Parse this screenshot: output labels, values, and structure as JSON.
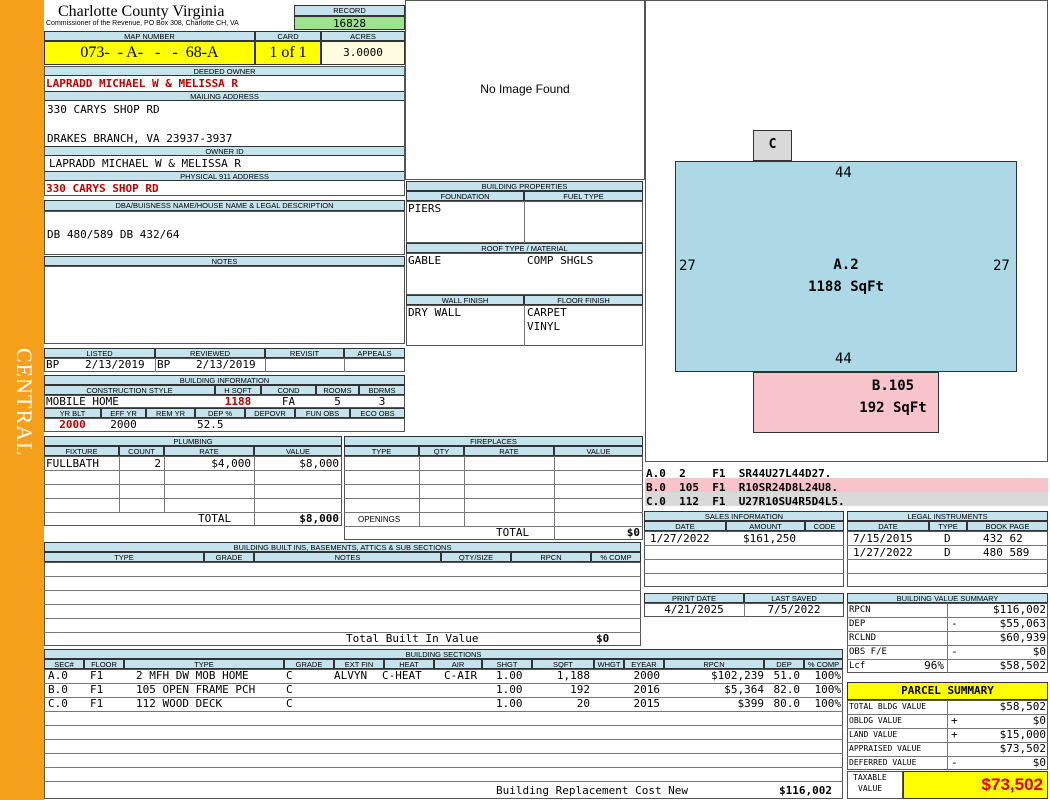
{
  "sidebar": {
    "label": "CENTRAL",
    "color": "#f5a01a"
  },
  "header": {
    "county": "Charlotte County Virginia",
    "commissioner": "Commissioner of the Revenue, PO Box 308, Charlotte CH, VA"
  },
  "record": {
    "label": "RECORD",
    "value": "16828"
  },
  "map_number": {
    "label": "MAP NUMBER",
    "value": "073-  - A-   -   -  68-A"
  },
  "card": {
    "label": "CARD",
    "value": "1 of 1"
  },
  "acres": {
    "label": "ACRES",
    "value": "3.0000"
  },
  "deeded_owner": {
    "label": "DEEDED OWNER",
    "value": "LAPRADD MICHAEL W & MELISSA R"
  },
  "mailing": {
    "label": "MAILING ADDRESS",
    "line1": "330 CARYS SHOP RD",
    "line2": "DRAKES BRANCH, VA 23937-3937"
  },
  "owner_id": {
    "label": "OWNER ID",
    "value": "LAPRADD MICHAEL W & MELISSA R"
  },
  "physical": {
    "label": "PHYSICAL 911 ADDRESS",
    "value": "330 CARYS SHOP RD"
  },
  "dba": {
    "label": "DBA/BUISNESS NAME/HOUSE NAME & LEGAL DESCRIPTION",
    "value": "DB 480/589 DB 432/64"
  },
  "notes": {
    "label": "NOTES"
  },
  "listed": {
    "listed_label": "LISTED",
    "reviewed_label": "REVIEWED",
    "revisit_label": "REVISIT",
    "appeals_label": "APPEALS",
    "listed_by": "BP",
    "listed_date": "2/13/2019",
    "reviewed_by": "BP",
    "reviewed_date": "2/13/2019"
  },
  "building_info": {
    "label": "BUILDING INFORMATION",
    "style_label": "CONSTRUCTION STYLE",
    "hsqft_label": "H SQFT",
    "cond_label": "COND",
    "rooms_label": "ROOMS",
    "bdrms_label": "BDRMS",
    "style": "MOBILE HOME",
    "hsqft": "1188",
    "cond": "FA",
    "rooms": "5",
    "bdrms": "3",
    "yrblt_label": "YR BLT",
    "effyr_label": "EFF YR",
    "remyr_label": "REM YR",
    "dep_label": "DEP %",
    "depovr_label": "DEPOVR",
    "funobs_label": "FUN OBS",
    "ecoobs_label": "ECO OBS",
    "yrblt": "2000",
    "effyr": "2000",
    "dep": "52.5"
  },
  "image": {
    "text": "No Image Found"
  },
  "building_props": {
    "label": "BUILDING PROPERTIES",
    "foundation_label": "FOUNDATION",
    "fuel_label": "FUEL TYPE",
    "foundation": "PIERS",
    "roof_label": "ROOF TYPE / MATERIAL",
    "roof_type": "GABLE",
    "roof_material": "COMP SHGLS",
    "wall_label": "WALL FINISH",
    "floor_label": "FLOOR FINISH",
    "wall": "DRY WALL",
    "floor1": "CARPET",
    "floor2": "VINYL"
  },
  "sketch": {
    "c_label": "C",
    "top": "44",
    "bottom": "44",
    "left": "27",
    "right": "27",
    "a_label": "A.2",
    "a_area": "1188 SqFt",
    "b_label": "B.105",
    "b_area": "192 SqFt"
  },
  "sketch_legend": [
    {
      "text": "A.0  2    F1  SR44U27L44D27.",
      "color": "#ffffff"
    },
    {
      "text": "B.0  105  F1  R10SR24D8L24U8.",
      "color": "#f7c4cc"
    },
    {
      "text": "C.0  112  F1  U27R10SU4R5D4L5.",
      "color": "#d9d9d9"
    }
  ],
  "plumbing": {
    "label": "PLUMBING",
    "cols": [
      "FIXTURE",
      "COUNT",
      "RATE",
      "VALUE"
    ],
    "rows": [
      {
        "fixture": "FULLBATH",
        "count": "2",
        "rate": "$4,000",
        "value": "$8,000"
      }
    ],
    "total_label": "TOTAL",
    "total": "$8,000"
  },
  "fireplaces": {
    "label": "FIREPLACES",
    "cols": [
      "TYPE",
      "QTY",
      "RATE",
      "VALUE"
    ],
    "openings_label": "OPENINGS",
    "total_label": "TOTAL",
    "total": "$0"
  },
  "builtins": {
    "label": "BUILDING BUILT INS, BASEMENTS, ATTICS & SUB SECTIONS",
    "cols": [
      "TYPE",
      "GRADE",
      "NOTES",
      "QTY/SIZE",
      "RPCN",
      "% COMP"
    ],
    "total_label": "Total Built In Value",
    "total": "$0"
  },
  "sales": {
    "label": "SALES INFORMATION",
    "cols": [
      "DATE",
      "AMOUNT",
      "CODE"
    ],
    "rows": [
      {
        "date": "1/27/2022",
        "amount": "$161,250",
        "code": ""
      }
    ]
  },
  "legal": {
    "label": "LEGAL INSTRUMENTS",
    "cols": [
      "DATE",
      "TYPE",
      "BOOK PAGE"
    ],
    "rows": [
      {
        "date": "7/15/2015",
        "type": "D",
        "book": "432 62"
      },
      {
        "date": "1/27/2022",
        "type": "D",
        "book": "480 589"
      }
    ]
  },
  "print": {
    "print_label": "PRINT DATE",
    "saved_label": "LAST SAVED",
    "print_date": "4/21/2025",
    "saved_date": "7/5/2022"
  },
  "bvs": {
    "label": "BUILDING VALUE SUMMARY",
    "rows": [
      {
        "label": "RPCN",
        "sign": "",
        "value": "$116,002"
      },
      {
        "label": "DEP",
        "sign": "-",
        "value": "$55,063"
      },
      {
        "label": "RCLND",
        "sign": "",
        "value": "$60,939"
      },
      {
        "label": "OBS F/E",
        "sign": "-",
        "value": "$0"
      },
      {
        "label": "Lcf",
        "sign": "96%",
        "value": "$58,502"
      }
    ]
  },
  "parcel": {
    "label": "PARCEL SUMMARY",
    "rows": [
      {
        "label": "TOTAL BLDG VALUE",
        "sign": "",
        "value": "$58,502"
      },
      {
        "label": "OBLDG VALUE",
        "sign": "+",
        "value": "$0"
      },
      {
        "label": "LAND VALUE",
        "sign": "+",
        "value": "$15,000"
      },
      {
        "label": "APPRAISED VALUE",
        "sign": "",
        "value": "$73,502"
      },
      {
        "label": "DEFERRED VALUE",
        "sign": "-",
        "value": "$0"
      }
    ],
    "taxable_label1": "TAXABLE",
    "taxable_label2": "VALUE",
    "taxable": "$73,502"
  },
  "sections": {
    "label": "BUILDING SECTIONS",
    "cols": [
      "SEC#",
      "FLOOR",
      "TYPE",
      "GRADE",
      "EXT FIN",
      "HEAT",
      "AIR",
      "SHGT",
      "SQFT",
      "WHGT",
      "EYEAR",
      "RPCN",
      "DEP",
      "% COMP"
    ],
    "rows": [
      {
        "sec": "A.0",
        "floor": "F1",
        "type": "2 MFH DW MOB HOME",
        "grade": "C",
        "extfin": "ALVYN",
        "heat": "C-HEAT",
        "air": "C-AIR",
        "shgt": "1.00",
        "sqft": "1,188",
        "whgt": "",
        "eyear": "2000",
        "rpcn": "$102,239",
        "dep": "51.0",
        "comp": "100%"
      },
      {
        "sec": "B.0",
        "floor": "F1",
        "type": "105 OPEN FRAME PCH",
        "grade": "C",
        "extfin": "",
        "heat": "",
        "air": "",
        "shgt": "1.00",
        "sqft": "192",
        "whgt": "",
        "eyear": "2016",
        "rpcn": "$5,364",
        "dep": "82.0",
        "comp": "100%"
      },
      {
        "sec": "C.0",
        "floor": "F1",
        "type": "112 WOOD DECK",
        "grade": "C",
        "extfin": "",
        "heat": "",
        "air": "",
        "shgt": "1.00",
        "sqft": "20",
        "whgt": "",
        "eyear": "2015",
        "rpcn": "$399",
        "dep": "80.0",
        "comp": "100%"
      }
    ],
    "brcn_label": "Building Replacement Cost New",
    "brcn": "$116,002"
  }
}
